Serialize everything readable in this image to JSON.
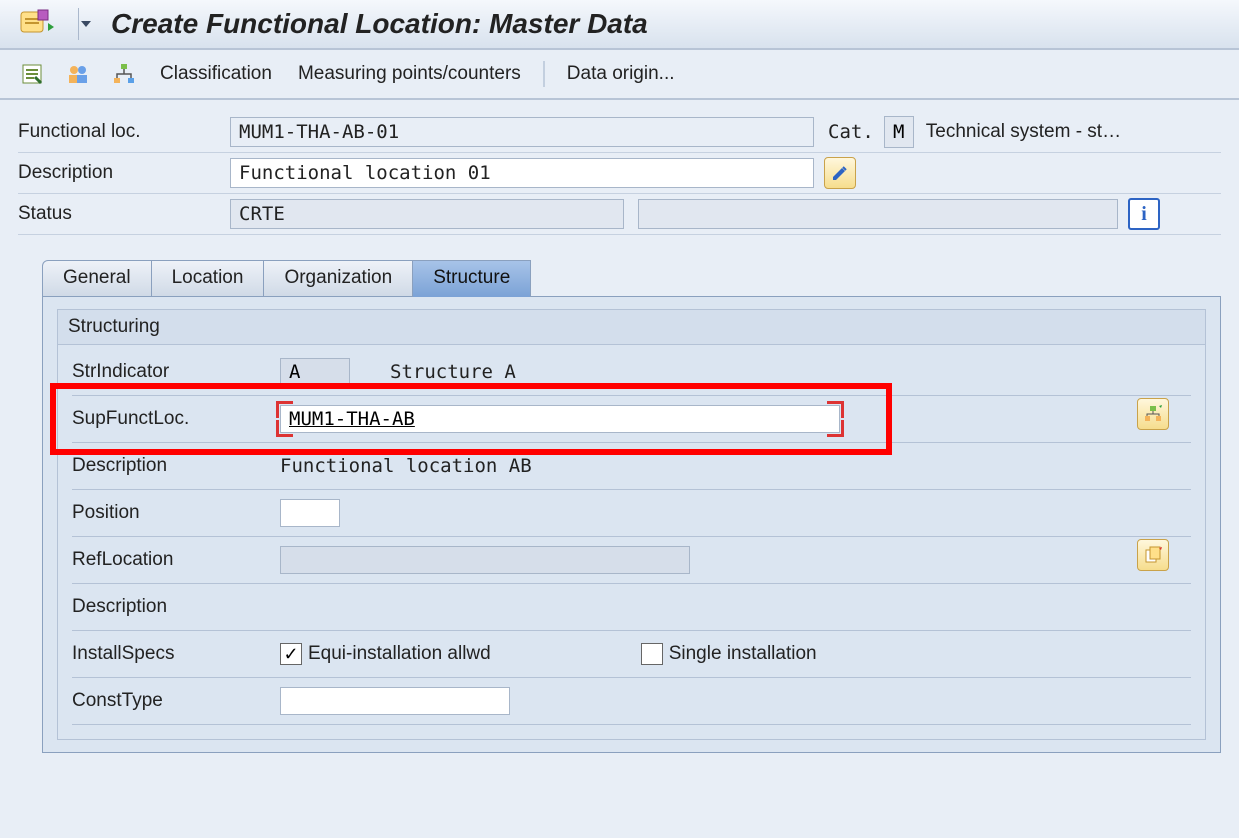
{
  "title": "Create Functional Location: Master Data",
  "toolbar": {
    "classification": "Classification",
    "measuring": "Measuring points/counters",
    "dataorigin": "Data origin..."
  },
  "header": {
    "funcloc_label": "Functional loc.",
    "funcloc_value": "MUM1-THA-AB-01",
    "cat_label": "Cat.",
    "cat_value": "M",
    "cat_text": "Technical system - st…",
    "desc_label": "Description",
    "desc_value": "Functional location 01",
    "status_label": "Status",
    "status_value": "CRTE"
  },
  "tabs": [
    "General",
    "Location",
    "Organization",
    "Structure"
  ],
  "active_tab": 3,
  "structuring": {
    "group_title": "Structuring",
    "strind_label": "StrIndicator",
    "strind_value": "A",
    "strind_text": "Structure A",
    "supfl_label": "SupFunctLoc.",
    "supfl_value": "MUM1-THA-AB",
    "desc_label": "Description",
    "desc_value": "Functional location AB",
    "position_label": "Position",
    "position_value": "",
    "refloc_label": "RefLocation",
    "refloc_value": "",
    "desc2_label": "Description",
    "install_label": "InstallSpecs",
    "equi_install_label": "Equi-installation allwd",
    "single_install_label": "Single installation",
    "equi_checked": true,
    "single_checked": false,
    "consttype_label": "ConstType",
    "consttype_value": ""
  }
}
